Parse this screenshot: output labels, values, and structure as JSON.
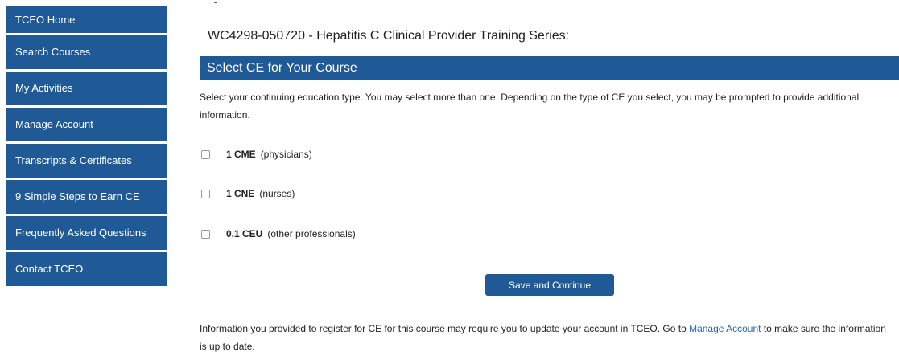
{
  "sidebar": {
    "items": [
      {
        "label": "TCEO Home"
      },
      {
        "label": "Search Courses"
      },
      {
        "label": "My Activities"
      },
      {
        "label": "Manage Account"
      },
      {
        "label": "Transcripts & Certificates"
      },
      {
        "label": "9 Simple Steps to Earn CE"
      },
      {
        "label": "Frequently Asked Questions"
      },
      {
        "label": "Contact TCEO"
      }
    ]
  },
  "main": {
    "course_title": "WC4298-050720 - Hepatitis C Clinical Provider Training Series:",
    "section_heading": "Select CE for Your Course",
    "intro": "Select your continuing education type. You may select more than one. Depending on the type of CE you select, you may be prompted to provide additional information.",
    "ce_options": [
      {
        "amount": "1 CME",
        "audience": "(physicians)",
        "checked": false
      },
      {
        "amount": "1 CNE",
        "audience": "(nurses)",
        "checked": false
      },
      {
        "amount": "0.1 CEU",
        "audience": "(other professionals)",
        "checked": false
      }
    ],
    "save_button_label": "Save and Continue",
    "footer_before_link": "Information you provided to register for CE for this course may require you to update your account in TCEO. Go to ",
    "footer_link": "Manage Account",
    "footer_after_link": " to make sure the information is up to date."
  },
  "colors": {
    "brand_blue": "#1f5a96",
    "link_blue": "#2a66a8"
  }
}
